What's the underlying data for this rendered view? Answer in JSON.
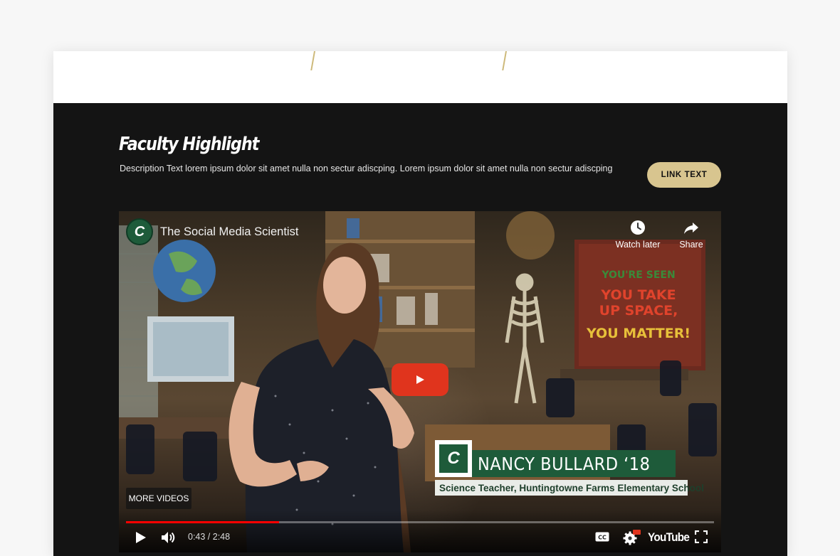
{
  "section": {
    "title": "Faculty Highlight",
    "description": "Description Text lorem ipsum dolor sit amet nulla non sectur adiscping. Lorem ipsum dolor sit amet nulla non sectur adiscping",
    "link_label": "LINK TEXT"
  },
  "video": {
    "channel_title": "The Social Media Scientist",
    "watch_later_label": "Watch later",
    "share_label": "Share",
    "more_videos_label": "MORE VIDEOS",
    "time_display": "0:43 / 2:48",
    "progress_fraction": 0.26,
    "youtube_label": "YouTube",
    "lower_third": {
      "logo_letter": "C",
      "name": "NANCY BULLARD ‘18",
      "subtitle": "Science Teacher, Huntingtowne Farms Elementary School"
    },
    "scene_sign": [
      "YOU'RE SEEN",
      "YOU TAKE",
      "UP SPACE,",
      "YOU MATTER!"
    ]
  },
  "colors": {
    "page_bg": "#f7f7f7",
    "dark_bg": "#141414",
    "accent_gold": "#d8c58f",
    "brand_green": "#1e5b3a",
    "play_red": "#e0341d",
    "progress_red": "#ff0000"
  },
  "icons": [
    "channel-avatar",
    "clock-icon",
    "share-icon",
    "play-icon",
    "volume-icon",
    "cc-icon",
    "settings-icon",
    "hd-badge",
    "fullscreen-icon"
  ]
}
